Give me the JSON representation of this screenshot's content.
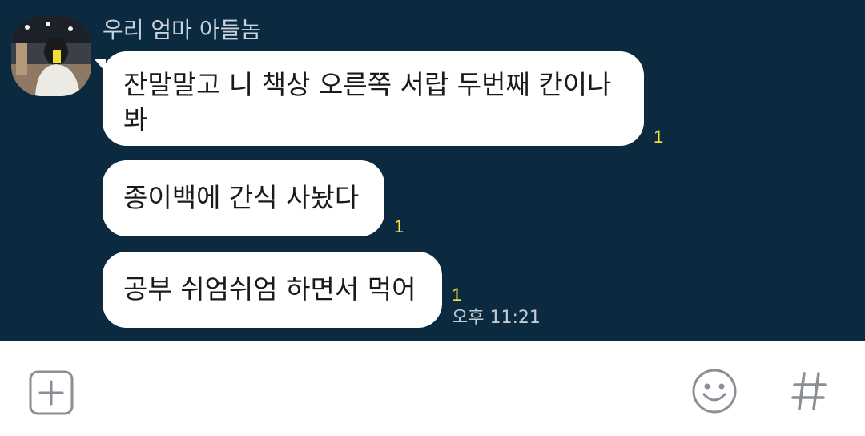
{
  "chat": {
    "sender_name": "우리 엄마 아들놈",
    "messages": [
      {
        "text": "잔말말고 니 책상 오른쪽 서랍 두번째 칸이나 봐",
        "unread": "1"
      },
      {
        "text": "종이백에 간식 사놨다",
        "unread": "1"
      },
      {
        "text": "공부 쉬엄쉬엄 하면서 먹어",
        "unread": "1"
      }
    ],
    "last_time": "오후 11:21"
  },
  "input_bar": {
    "attach_icon": "plus-icon",
    "emoji_icon": "emoji-icon",
    "hash_icon": "hashtag-icon"
  },
  "colors": {
    "chat_background": "#0b2a3f",
    "bubble": "#ffffff",
    "unread_count": "#f6e33f"
  }
}
